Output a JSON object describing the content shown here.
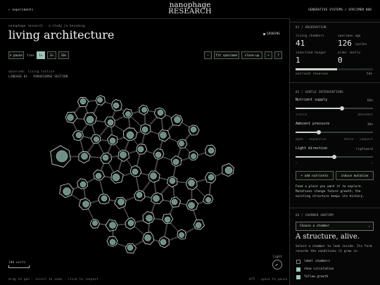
{
  "topbar": {
    "back": "← experiments",
    "brand_line1": "nanophage",
    "brand_line2": "RESEARCH",
    "right": "GENERATIVE SYSTEMS / SPECIMEN 008"
  },
  "header": {
    "breadcrumb": "nanophage research · a study in becoming",
    "title": "living architecture",
    "live_label": "GROWING"
  },
  "toolbar": {
    "pause": "⏸ pause",
    "time_label": "time",
    "speeds": [
      "1×",
      "3×",
      "10×"
    ],
    "zoom_out": "−",
    "fit": "fit specimen",
    "closeup": "close-up",
    "zoom_in": "+",
    "help": "?"
  },
  "canvas": {
    "label1": "observed: living lattice",
    "label2": "LINEAGE 01 · PARADIGMSE SECTION",
    "scale": "100 units",
    "light": "light",
    "hint_left": "drag to pan · scroll to zoom · click to inspect",
    "hint_right": "875 · space to pause"
  },
  "panel": {
    "observation": {
      "header": "01 / OBSERVATION",
      "living_label": "living chambers",
      "living_value": "41",
      "age_label": "specimen age",
      "age_value": "126",
      "age_unit": "cycles",
      "hunger_label": "inherited hunger",
      "hunger_value": "1",
      "shells_label": "older shells",
      "shells_value": "0",
      "meter_label": "nutrient reserves",
      "meter_value": "54%",
      "meter_fraction": 0.54
    },
    "interventions": {
      "header": "02 / GENTLE INTERVENTIONS",
      "sliders": [
        {
          "label": "Nutrient supply",
          "value": "60%",
          "fraction": 0.6,
          "min": "scarce",
          "max": "abundant"
        },
        {
          "label": "Ambient pressure",
          "value": "30%",
          "fraction": 0.3,
          "min": "open · expansive",
          "max": "dense · compact"
        },
        {
          "label": "Light direction",
          "value": "rightward",
          "fraction": 0.5,
          "min": "←",
          "max": "→"
        }
      ],
      "add_nutrients": "+ add nutrients",
      "induce_mutation": "induce mutation",
      "note": "Feed a place you want it to explore. Mutations change future growth; the existing structure keeps its history."
    },
    "anatomy": {
      "header": "03 / CHAMBER ANATOMY",
      "select_placeholder": "Choose a chamber",
      "title": "A structure, alive.",
      "description": "Select a chamber to look inside. Its form records the conditions it grew in.",
      "checks": [
        {
          "label": "label chambers",
          "checked": false
        },
        {
          "label": "show circulation",
          "checked": true
        },
        {
          "label": "follow growth",
          "checked": true
        }
      ]
    }
  },
  "colors": {
    "accent": "#9fc5bb",
    "chamber_fill": "#6e9086",
    "background": "#000000"
  }
}
